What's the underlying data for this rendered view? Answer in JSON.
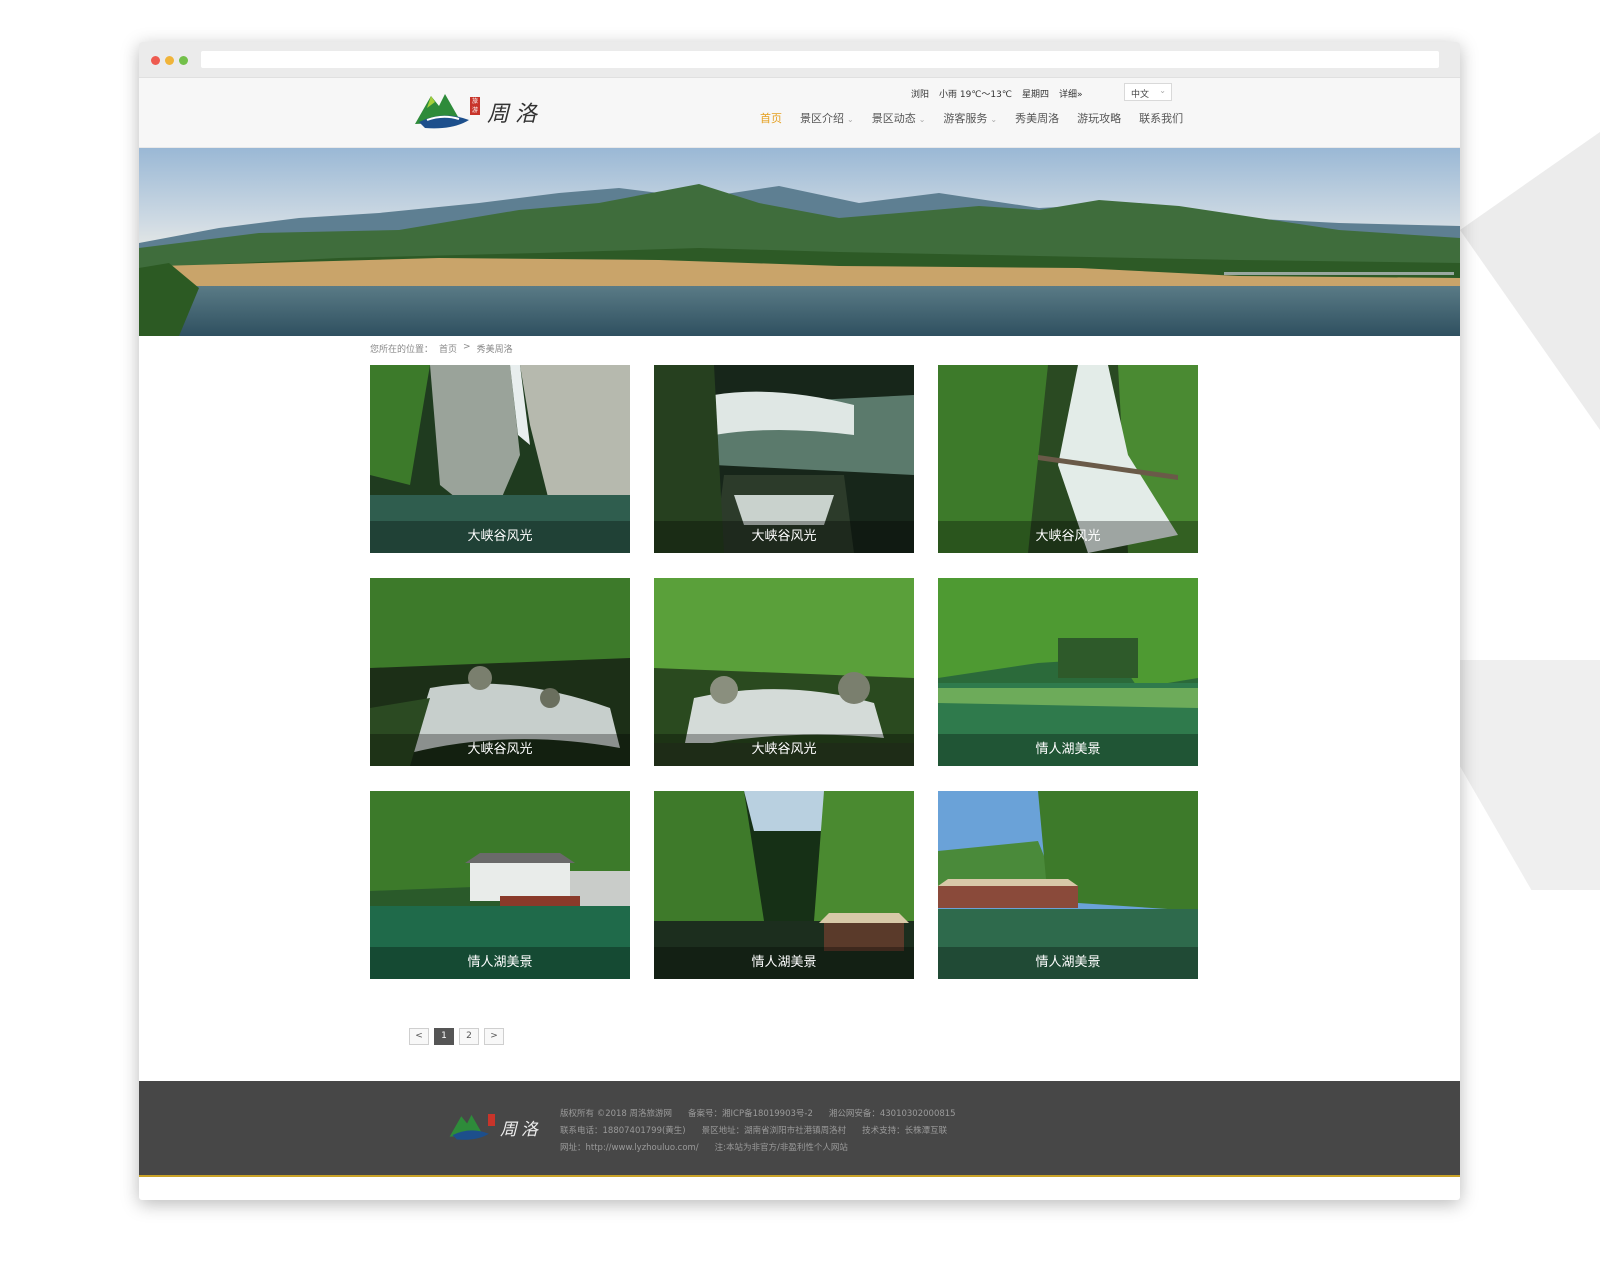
{
  "header": {
    "logo_text": "周洛",
    "logo_seal": "旅游",
    "weather": {
      "city": "浏阳",
      "condition": "小雨 19℃～13℃",
      "weekday": "星期四",
      "detail": "详细»"
    },
    "language": "中文",
    "nav": [
      {
        "label": "首页"
      },
      {
        "label": "景区介绍"
      },
      {
        "label": "景区动态"
      },
      {
        "label": "游客服务"
      },
      {
        "label": "秀美周洛"
      },
      {
        "label": "游玩攻略"
      },
      {
        "label": "联系我们"
      }
    ]
  },
  "breadcrumb": {
    "prefix": "您所在的位置：",
    "home": "首页",
    "sep": ">",
    "current": "秀美周洛"
  },
  "gallery": [
    {
      "caption": "大峡谷风光"
    },
    {
      "caption": "大峡谷风光"
    },
    {
      "caption": "大峡谷风光"
    },
    {
      "caption": "大峡谷风光"
    },
    {
      "caption": "大峡谷风光"
    },
    {
      "caption": "情人湖美景"
    },
    {
      "caption": "情人湖美景"
    },
    {
      "caption": "情人湖美景"
    },
    {
      "caption": "情人湖美景"
    }
  ],
  "pagination": {
    "prev": "<",
    "pages": [
      "1",
      "2"
    ],
    "next": ">",
    "current": "1"
  },
  "footer": {
    "logo_text": "周洛",
    "line1": [
      "版权所有 ©2018 周洛旅游网",
      "备案号：湘ICP备18019903号-2",
      "湘公网安备：43010302000815"
    ],
    "line2": [
      "联系电话：18807401799(黄生)",
      "景区地址：湖南省浏阳市社港镇周洛村",
      "技术支持：长株潭互联"
    ],
    "line3": [
      "网址：http://www.lyzhouluo.com/",
      "注:本站为非官方/非盈利性个人网站"
    ]
  },
  "colors": {
    "accent": "#e5a021",
    "footer_bg": "#474747"
  }
}
